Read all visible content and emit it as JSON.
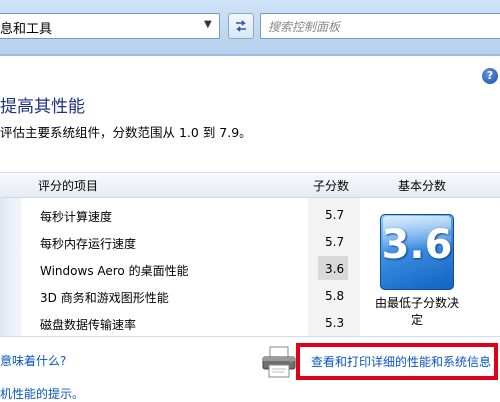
{
  "toolbar": {
    "address_text": "息和工具",
    "search_placeholder": "搜索控制面板"
  },
  "help": {
    "glyph": "?"
  },
  "page": {
    "heading": "提高其性能",
    "description": "评估主要系统组件，分数范围从 1.0 到 7.9。"
  },
  "table": {
    "headers": {
      "component": "评分的项目",
      "subscore": "子分数",
      "base_score": "基本分数"
    },
    "rows": [
      {
        "label": "每秒计算速度",
        "value": "5.7"
      },
      {
        "label": "每秒内存运行速度",
        "value": "5.7"
      },
      {
        "label": "Windows Aero 的桌面性能",
        "value": "3.6"
      },
      {
        "label": "3D 商务和游戏图形性能",
        "value": "5.8"
      },
      {
        "label": "磁盘数据传输速率",
        "value": "5.3"
      }
    ],
    "base_score": "3.6",
    "base_score_note": "由最低子分数决定"
  },
  "links": {
    "meaning": "意味着什么?",
    "detail": "查看和打印详细的性能和系统信息",
    "tips": "机性能的提示。"
  },
  "colors": {
    "link": "#0a55c9",
    "heading": "#1e3287",
    "highlight_box": "#e0001a"
  },
  "icons": {
    "refresh": "refresh-icon",
    "printer": "printer-icon",
    "help": "help-icon"
  }
}
